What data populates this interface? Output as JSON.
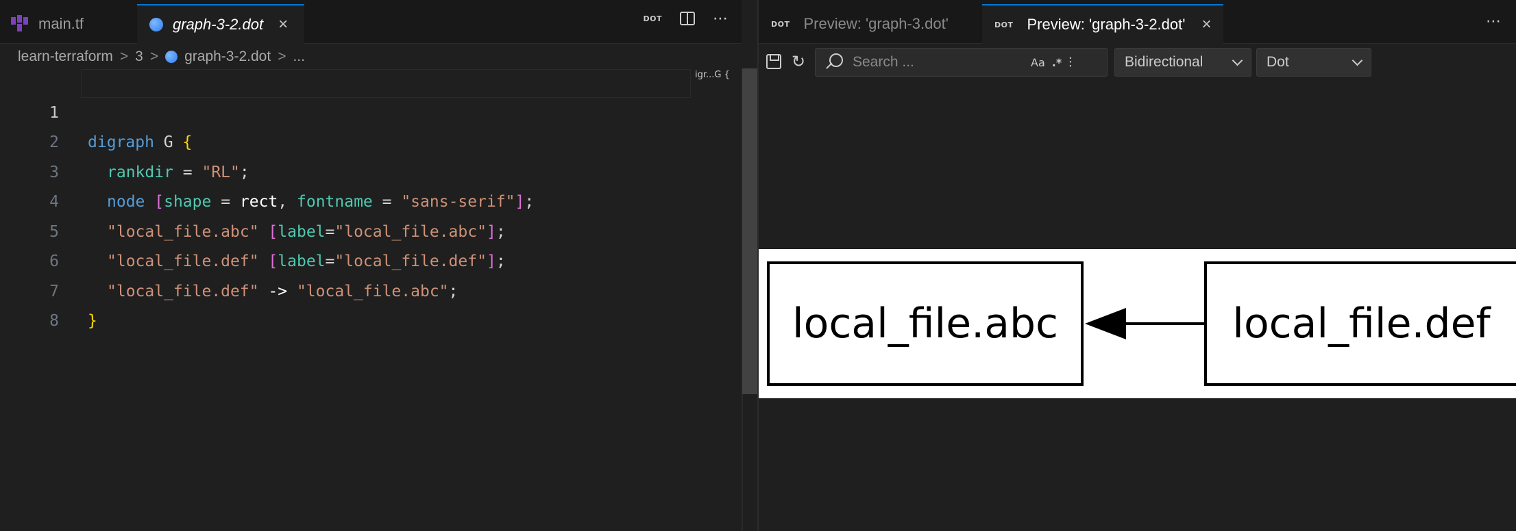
{
  "editor": {
    "tabs": [
      {
        "label": "main.tf",
        "icon": "terraform-icon",
        "active": false
      },
      {
        "label": "graph-3-2.dot",
        "icon": "dot-file-icon",
        "active": true,
        "close": "×"
      }
    ],
    "actions": {
      "dot_badge": "DOT",
      "more": "⋯"
    },
    "breadcrumb": [
      {
        "label": "learn-terraform"
      },
      {
        "label": "3"
      },
      {
        "label": "graph-3-2.dot"
      },
      {
        "label": "..."
      }
    ],
    "breadcrumb_sep": ">",
    "minimap_label": "igr...G {",
    "line_numbers": [
      "1",
      "2",
      "3",
      "4",
      "5",
      "6",
      "7",
      "8"
    ],
    "code": {
      "l1": {
        "kw": "digraph",
        "name": " G ",
        "brace": "{"
      },
      "l2": {
        "attr": "rankdir",
        "eq": " = ",
        "val": "\"RL\"",
        "semi": ";"
      },
      "l3": {
        "kw": "node",
        "sp": " ",
        "open": "[",
        "a1": "shape",
        "eq1": " = ",
        "v1": "rect",
        "comma": ", ",
        "a2": "fontname",
        "eq2": " = ",
        "v2": "\"sans-serif\"",
        "close": "]",
        "semi": ";"
      },
      "l4": {
        "node": "\"local_file.abc\"",
        "sp": " ",
        "open": "[",
        "attr": "label",
        "eq": "=",
        "val": "\"local_file.abc\"",
        "close": "]",
        "semi": ";"
      },
      "l5": {
        "node": "\"local_file.def\"",
        "sp": " ",
        "open": "[",
        "attr": "label",
        "eq": "=",
        "val": "\"local_file.def\"",
        "close": "]",
        "semi": ";"
      },
      "l6": {
        "from": "\"local_file.def\"",
        "arrow": " -> ",
        "to": "\"local_file.abc\"",
        "semi": ";"
      },
      "l7": {
        "brace": "}"
      }
    }
  },
  "preview": {
    "tabs": [
      {
        "badge": "DOT",
        "label": "Preview: 'graph-3.dot'",
        "active": false
      },
      {
        "badge": "DOT",
        "label": "Preview: 'graph-3-2.dot'",
        "active": true,
        "close": "×"
      }
    ],
    "more": "⋯",
    "toolbar": {
      "refresh": "↻",
      "search_placeholder": "Search ...",
      "opt_case": "Aa",
      "opt_regex": ".*",
      "opt_filter": "⫶",
      "direction": "Bidirectional",
      "engine": "Dot"
    },
    "graph": {
      "nodes": [
        "local_file.abc",
        "local_file.def"
      ],
      "edge": {
        "from": "local_file.def",
        "to": "local_file.abc"
      }
    }
  },
  "colors": {
    "accent": "#0078d4",
    "keyword": "#569cd6",
    "attribute": "#9cdcfe",
    "string": "#ce9178",
    "identifier": "#4ec9b0",
    "terraform": "#7b42bc"
  }
}
